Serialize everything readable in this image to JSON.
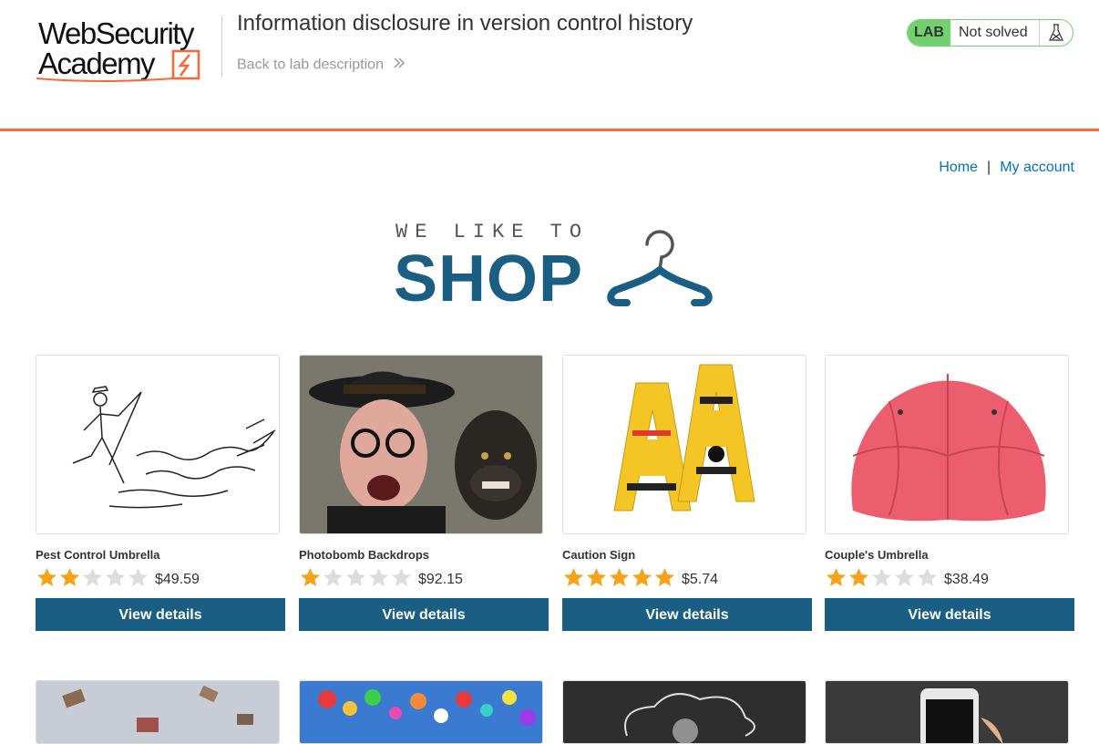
{
  "header": {
    "logo_line1": "WebSecurity",
    "logo_line2": "Academy",
    "lab_title": "Information disclosure in version control history",
    "back_link": "Back to lab description",
    "lab_badge": "LAB",
    "lab_status": "Not solved"
  },
  "nav": {
    "home": "Home",
    "separator": "|",
    "account": "My account"
  },
  "banner": {
    "top_text": "WE LIKE TO",
    "main_text": "SHOP"
  },
  "products": [
    {
      "name": "Pest Control Umbrella",
      "rating": 2,
      "price": "$49.59",
      "button": "View details",
      "image": "sketch-umbrella-image"
    },
    {
      "name": "Photobomb Backdrops",
      "rating": 1,
      "price": "$92.15",
      "button": "View details",
      "image": "man-and-monkey-image"
    },
    {
      "name": "Caution Sign",
      "rating": 5,
      "price": "$5.74",
      "button": "View details",
      "image": "caution-sign-image"
    },
    {
      "name": "Couple's Umbrella",
      "rating": 2,
      "price": "$38.49",
      "button": "View details",
      "image": "red-umbrella-image"
    }
  ],
  "colors": {
    "accent": "#ff6633",
    "button": "#1b5e83",
    "link": "#0071bc",
    "lab_green": "#70d16d",
    "star_on": "#f7a21b",
    "star_off": "#dddddd"
  }
}
